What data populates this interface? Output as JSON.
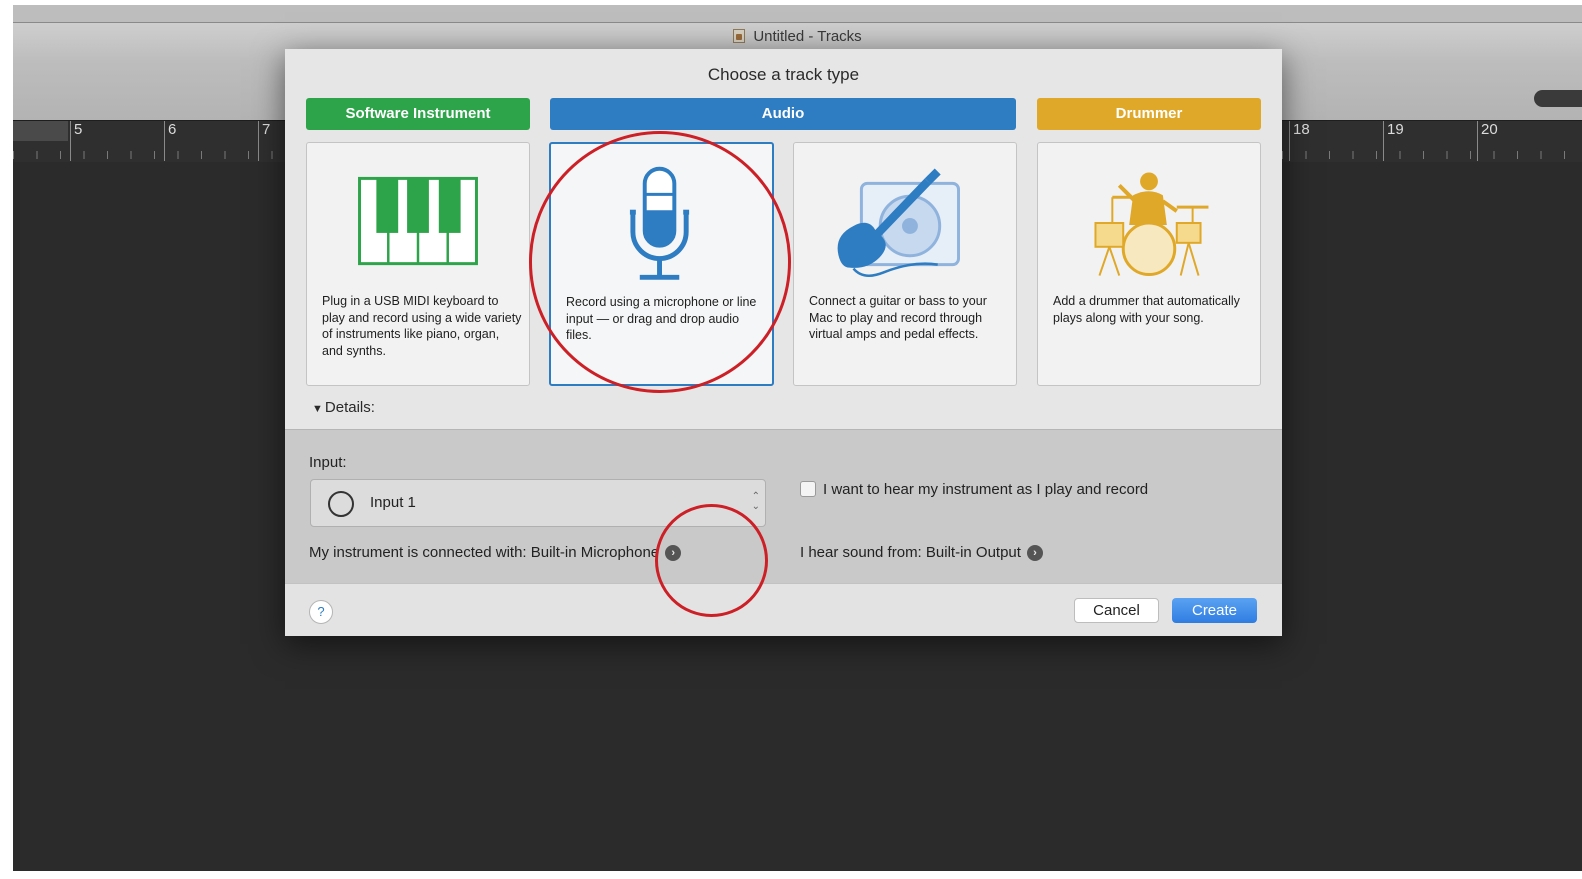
{
  "window": {
    "title": "Untitled - Tracks"
  },
  "ruler": {
    "bars_left": [
      "5",
      "6",
      "7"
    ],
    "bars_right": [
      "18",
      "19",
      "20"
    ]
  },
  "dialog": {
    "title": "Choose a track type",
    "categories": {
      "software": "Software Instrument",
      "audio": "Audio",
      "drummer": "Drummer"
    },
    "cards": {
      "software": "Plug in a USB MIDI keyboard to play and record using a wide variety of instruments like piano, organ, and synths.",
      "mic": "Record using a microphone or line input — or drag and drop audio files.",
      "guitar": "Connect a guitar or bass to your Mac to play and record through virtual amps and pedal effects.",
      "drummer": "Add a drummer that automatically plays along with your song."
    },
    "details_label": "Details:",
    "input_label": "Input:",
    "input_value": "Input 1",
    "connected_text": "My instrument is connected with: Built-in Microphone",
    "monitor_label": "I want to hear my instrument as I play and record",
    "output_text": "I hear sound from: Built-in Output",
    "help_label": "?",
    "cancel_label": "Cancel",
    "create_label": "Create"
  },
  "colors": {
    "software": "#2ea44a",
    "audio": "#2e7cc1",
    "drummer": "#e0a828",
    "annotation": "#cc1f26"
  }
}
